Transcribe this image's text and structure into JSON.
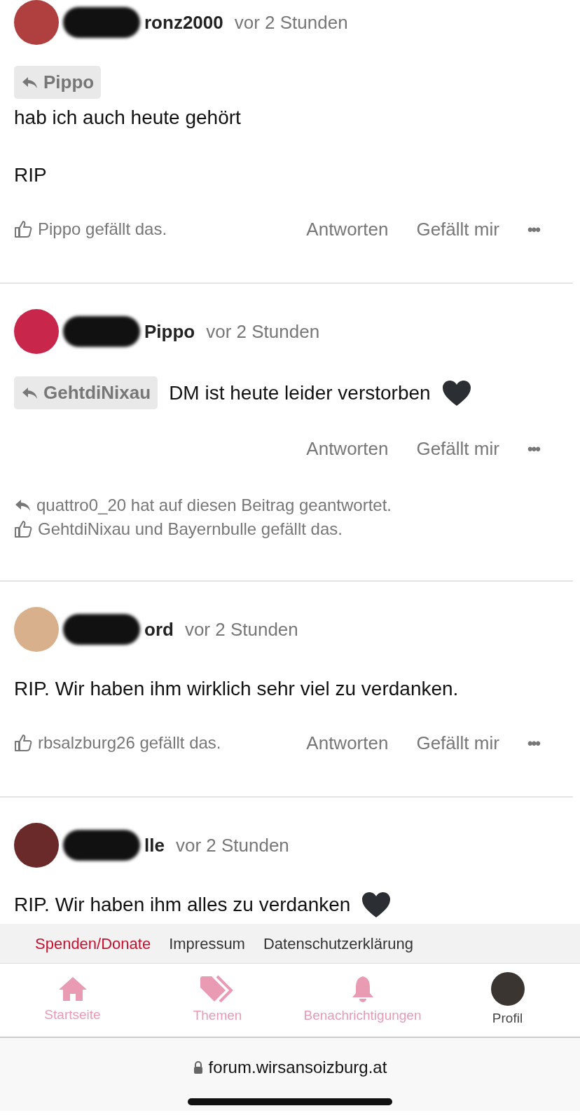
{
  "posts": [
    {
      "kind": "quote_above",
      "username": "ronz2000",
      "time": "vor 2 Stunden",
      "reply_to": "Pippo",
      "body": [
        "hab ich auch heute gehört",
        "RIP"
      ],
      "actions": [
        "Antworten",
        "Gefällt mir"
      ],
      "more": "•••",
      "liked_text": "Pippo gefällt das."
    },
    {
      "kind": "quote_inline",
      "username": "Pippo",
      "time": "vor 2 Stunden",
      "reply_to": "GehtdiNixau",
      "body": [
        "DM ist heute leider verstorben"
      ],
      "heart": true,
      "actions": [
        "Antworten",
        "Gefällt mir"
      ],
      "more": "•••",
      "replied_text": "quattro0_20 hat auf diesen Beitrag geantwortet.",
      "liked_text": "GehtdiNixau und Bayernbulle gefällt das."
    },
    {
      "kind": "plain",
      "username": "ord",
      "time": "vor 2 Stunden",
      "body": [
        "RIP. Wir haben ihm wirklich sehr viel zu verdanken."
      ],
      "actions": [
        "Antworten",
        "Gefällt mir"
      ],
      "more": "•••",
      "liked_text": "rbsalzburg26 gefällt das."
    },
    {
      "kind": "plain",
      "username": "lle",
      "time": "vor 2 Stunden",
      "body": [
        "RIP. Wir haben ihm alles zu verdanken"
      ],
      "heart": true
    }
  ],
  "footer_links": [
    {
      "label": "Spenden/Donate",
      "color": "#c8102e"
    },
    {
      "label": "Impressum",
      "color": "#333333"
    },
    {
      "label": "Datenschutzerklärung",
      "color": "#333333"
    }
  ],
  "nav": [
    {
      "kind": "home",
      "label": "Startseite"
    },
    {
      "kind": "tag",
      "label": "Themen"
    },
    {
      "kind": "bell",
      "label": "Benachrichtigungen"
    },
    {
      "kind": "avatar",
      "label": "Profil"
    }
  ],
  "url": "forum.wirsansoizburg.at"
}
